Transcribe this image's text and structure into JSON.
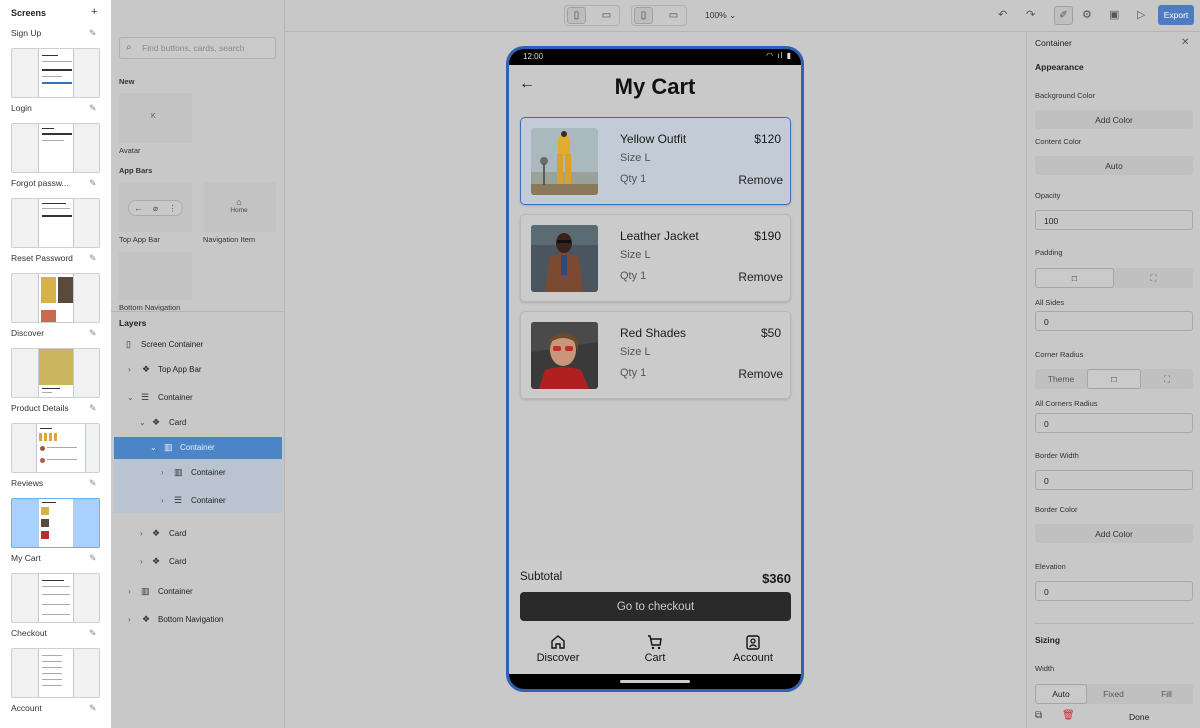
{
  "screens": {
    "title": "Screens",
    "add_label": "+",
    "items": [
      {
        "label": "Sign Up"
      },
      {
        "label": "Login"
      },
      {
        "label": "Forgot passw..."
      },
      {
        "label": "Reset Password"
      },
      {
        "label": "Discover"
      },
      {
        "label": "Product Details"
      },
      {
        "label": "Reviews"
      },
      {
        "label": "My Cart"
      },
      {
        "label": "Checkout"
      },
      {
        "label": "Account"
      }
    ],
    "active": "My Cart"
  },
  "library": {
    "search_placeholder": "Find buttons, cards, search",
    "sections": {
      "new": "New",
      "app_bars": "App Bars"
    },
    "tiles": {
      "avatar": "Avatar",
      "avatar_letter": "K",
      "top_app_bar": "Top App Bar",
      "navigation_item": "Navigation Item",
      "navigation_item_text": "Home",
      "bottom_navigation": "Bottom Navigation"
    }
  },
  "layers": {
    "title": "Layers",
    "items": [
      {
        "label": "Screen Container"
      },
      {
        "label": "Top App Bar"
      },
      {
        "label": "Container"
      },
      {
        "label": "Card"
      },
      {
        "label": "Container"
      },
      {
        "label": "Container"
      },
      {
        "label": "Container"
      },
      {
        "label": "Card"
      },
      {
        "label": "Card"
      },
      {
        "label": "Container"
      },
      {
        "label": "Bottom Navigation"
      }
    ]
  },
  "toolbar": {
    "zoom": "100%",
    "export_label": "Export"
  },
  "phone": {
    "status_time": "12:00",
    "title": "My Cart",
    "cart_items": [
      {
        "name": "Yellow Outfit",
        "price": "$120",
        "size": "Size L",
        "qty": "Qty 1",
        "remove": "Remove"
      },
      {
        "name": "Leather Jacket",
        "price": "$190",
        "size": "Size L",
        "qty": "Qty 1",
        "remove": "Remove"
      },
      {
        "name": "Red Shades",
        "price": "$50",
        "size": "Size L",
        "qty": "Qty 1",
        "remove": "Remove"
      }
    ],
    "subtotal_label": "Subtotal",
    "subtotal_value": "$360",
    "checkout_label": "Go to checkout",
    "nav": [
      {
        "label": "Discover",
        "icon": "home-icon"
      },
      {
        "label": "Cart",
        "icon": "cart-icon"
      },
      {
        "label": "Account",
        "icon": "account-icon"
      }
    ]
  },
  "properties": {
    "title": "Container",
    "appearance": "Appearance",
    "background_color_label": "Background Color",
    "background_color_btn": "Add Color",
    "content_color_label": "Content Color",
    "content_color_btn": "Auto",
    "opacity_label": "Opacity",
    "opacity_value": "100",
    "padding_label": "Padding",
    "all_sides_label": "All Sides",
    "all_sides_value": "0",
    "corner_radius_label": "Corner Radius",
    "corner_radius_theme": "Theme",
    "all_corners_label": "All Corners Radius",
    "all_corners_value": "0",
    "border_width_label": "Border Width",
    "border_width_value": "0",
    "border_color_label": "Border Color",
    "border_color_btn": "Add Color",
    "elevation_label": "Elevation",
    "elevation_value": "0",
    "sizing": "Sizing",
    "width_label": "Width",
    "width_options": [
      "Auto",
      "Fixed",
      "Fill"
    ],
    "width_selected": "Auto",
    "done_label": "Done"
  },
  "colors": {
    "accent": "#2f62b5",
    "export_bg": "#4f7bc3",
    "selected_layer": "#4c84c8",
    "active_thumb": "#a8d1ff"
  }
}
